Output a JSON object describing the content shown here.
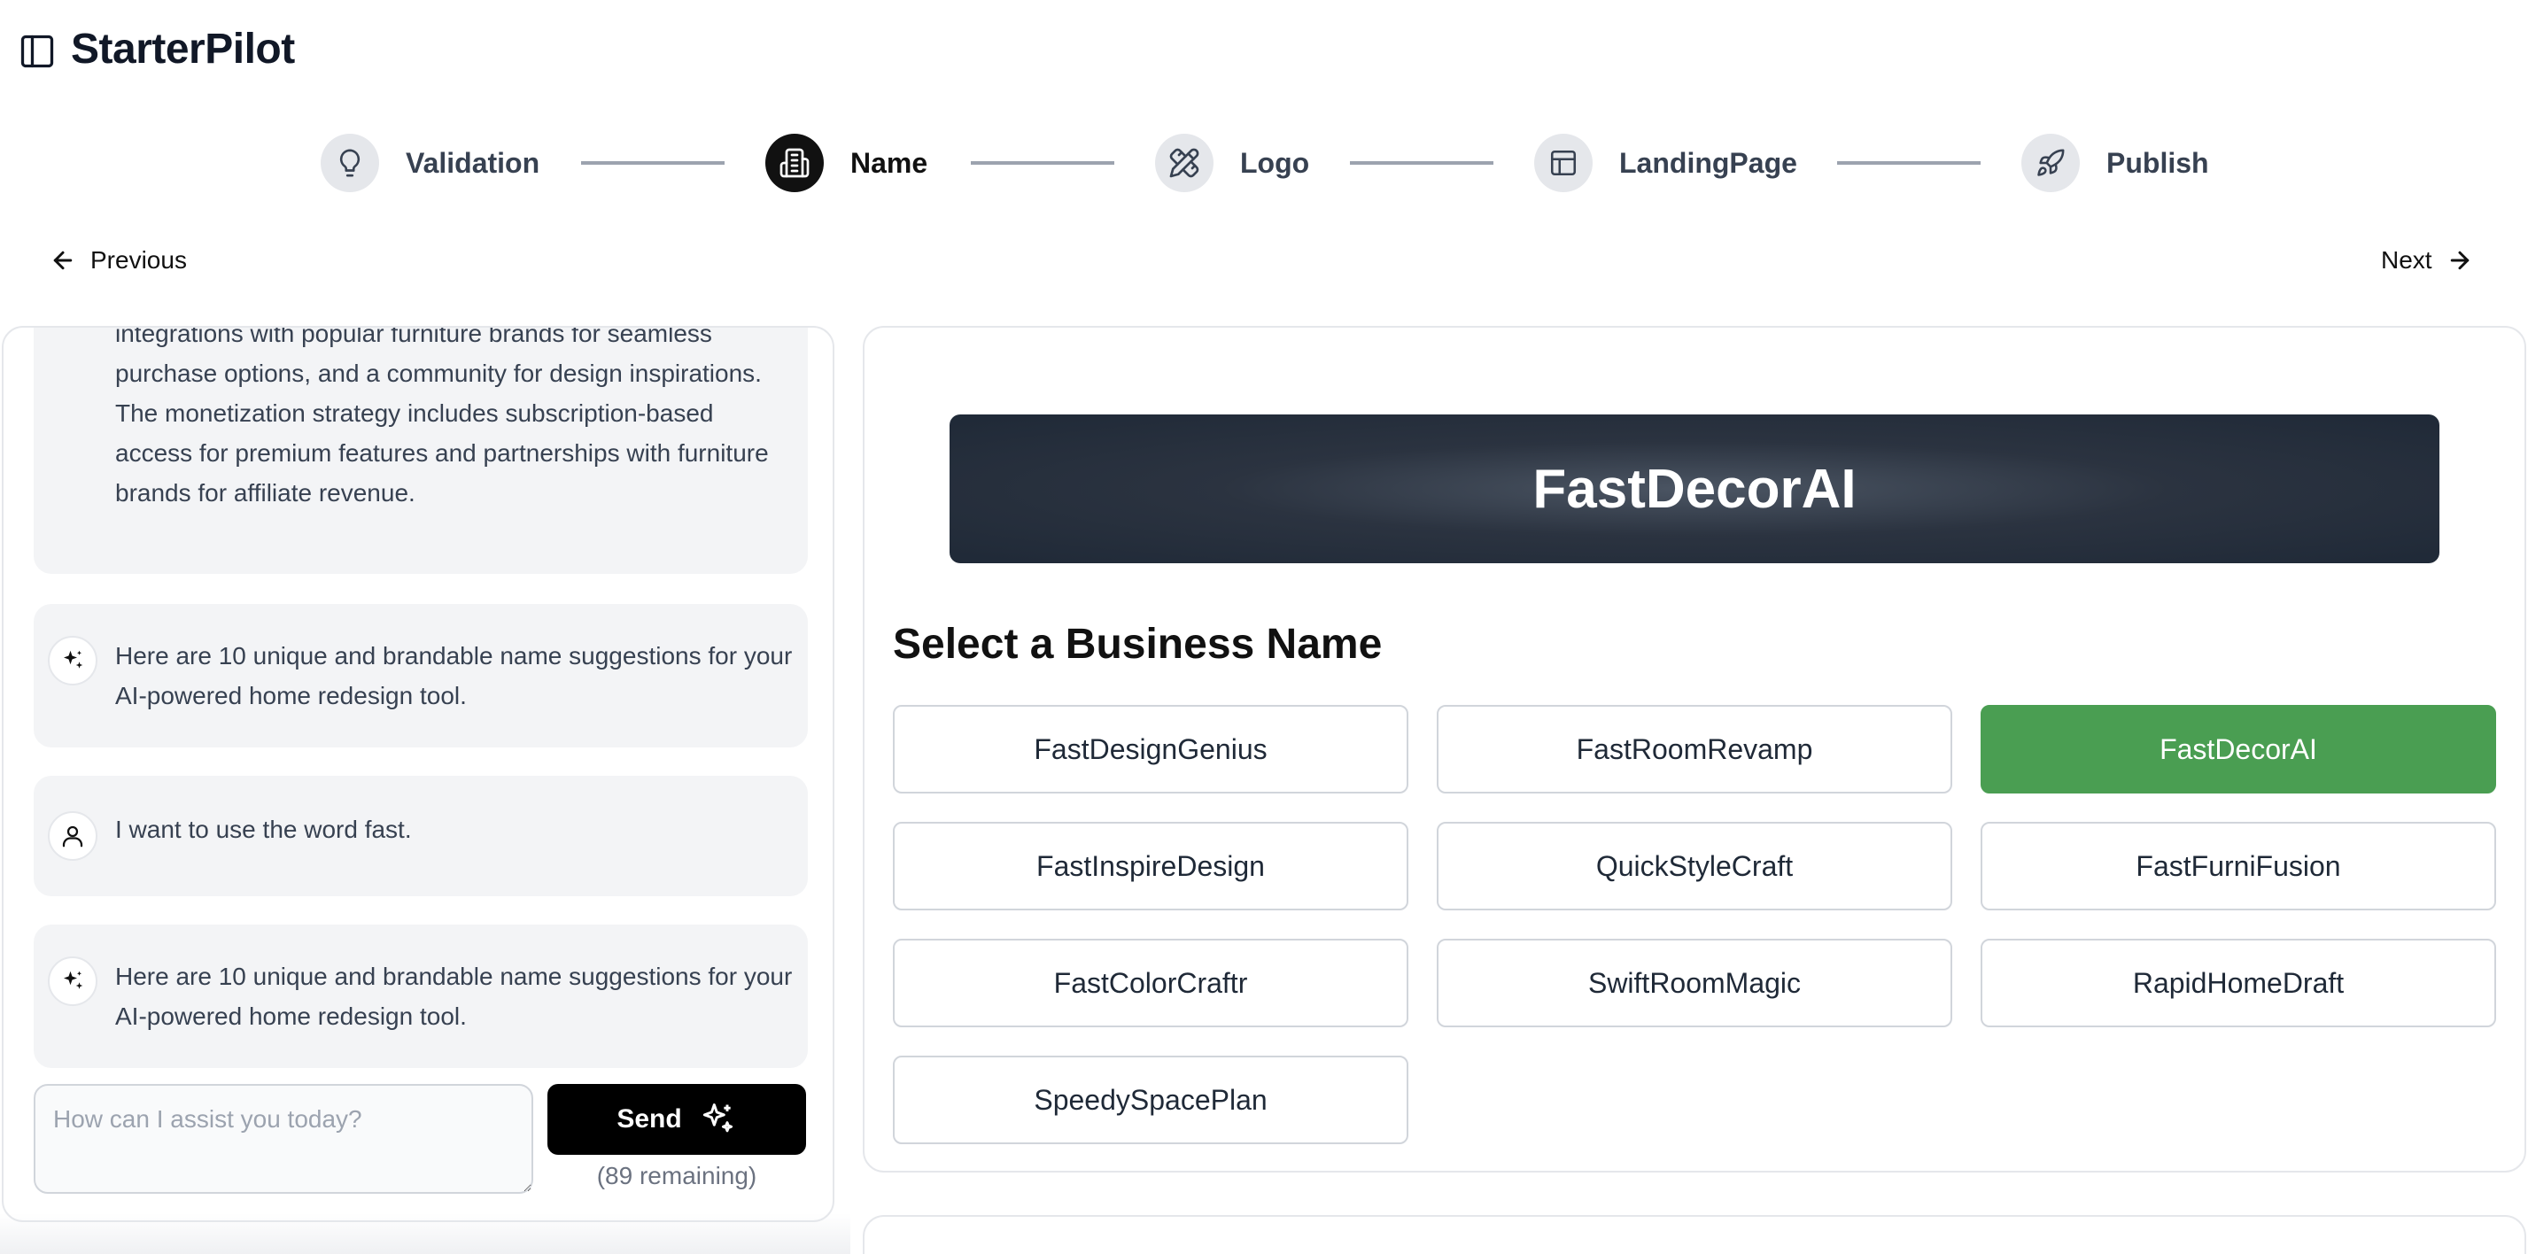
{
  "app": {
    "title": "StarterPilot"
  },
  "stepper": {
    "steps": [
      {
        "label": "Validation",
        "icon": "lightbulb-icon",
        "active": false
      },
      {
        "label": "Name",
        "icon": "building-icon",
        "active": true
      },
      {
        "label": "Logo",
        "icon": "pencil-ruler-icon",
        "active": false
      },
      {
        "label": "LandingPage",
        "icon": "layout-icon",
        "active": false
      },
      {
        "label": "Publish",
        "icon": "rocket-icon",
        "active": false
      }
    ]
  },
  "nav": {
    "previous_label": "Previous",
    "next_label": "Next"
  },
  "chat": {
    "messages": [
      {
        "role": "assistant",
        "text": "integrations with popular furniture brands for seamless purchase options, and a community for design inspirations. The monetization strategy includes subscription-based access for premium features and partnerships with furniture brands for affiliate revenue."
      },
      {
        "role": "assistant",
        "text": "Here are 10 unique and brandable name suggestions for your AI-powered home redesign tool."
      },
      {
        "role": "user",
        "text": "I want to use the word fast."
      },
      {
        "role": "assistant",
        "text": "Here are 10 unique and brandable name suggestions for your AI-powered home redesign tool."
      }
    ],
    "input": {
      "placeholder": "How can I assist you today?",
      "value": ""
    },
    "send_label": "Send",
    "remaining": "(89 remaining)"
  },
  "name_selection": {
    "selected_name": "FastDecorAI",
    "section_title": "Select a Business Name",
    "options": [
      "FastDesignGenius",
      "FastRoomRevamp",
      "FastDecorAI",
      "FastInspireDesign",
      "QuickStyleCraft",
      "FastFurniFusion",
      "FastColorCraftr",
      "SwiftRoomMagic",
      "RapidHomeDraft",
      "SpeedySpacePlan"
    ],
    "selected_index": 2
  },
  "colors": {
    "selected": "#4a9e52",
    "active_step": "#111111",
    "hero": "#1f2937"
  }
}
